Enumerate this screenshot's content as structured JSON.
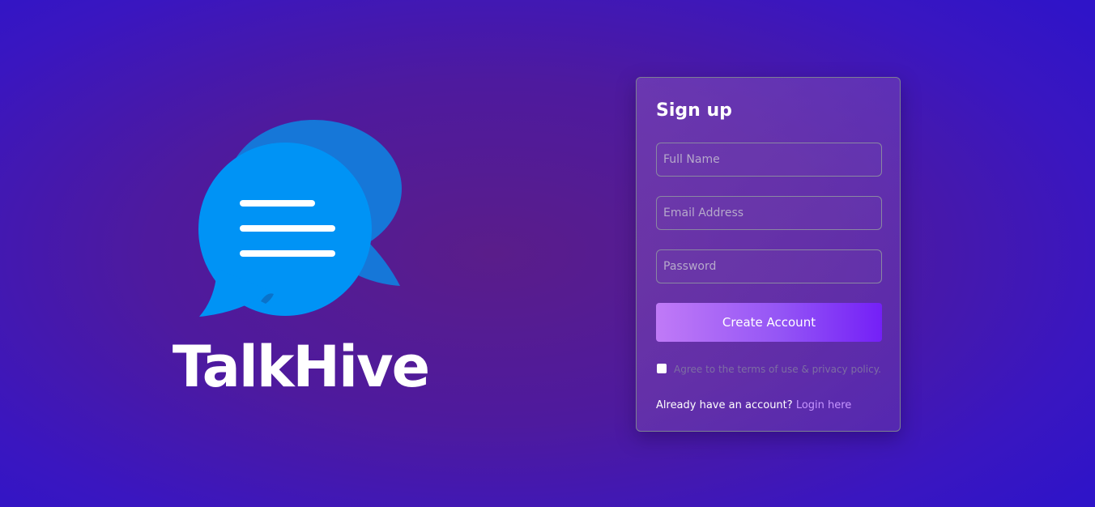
{
  "brand": {
    "name": "TalkHive",
    "logo_icon": "chat-bubbles-icon",
    "colors": {
      "bubble_front": "#0093f5",
      "bubble_back": "#1677d8",
      "lines": "#ffffff"
    }
  },
  "signup": {
    "title": "Sign up",
    "full_name_placeholder": "Full Name",
    "full_name_value": "",
    "email_placeholder": "Email Address",
    "email_value": "",
    "password_placeholder": "Password",
    "password_value": "",
    "create_button_label": "Create Account",
    "terms_checked": false,
    "terms_text": "Agree to the terms of use & privacy policy.",
    "login_prompt": "Already have an account?",
    "login_link_label": "Login here"
  },
  "colors": {
    "accent_start": "#c07af7",
    "accent_end": "#7420f7",
    "link": "#c695ff"
  }
}
